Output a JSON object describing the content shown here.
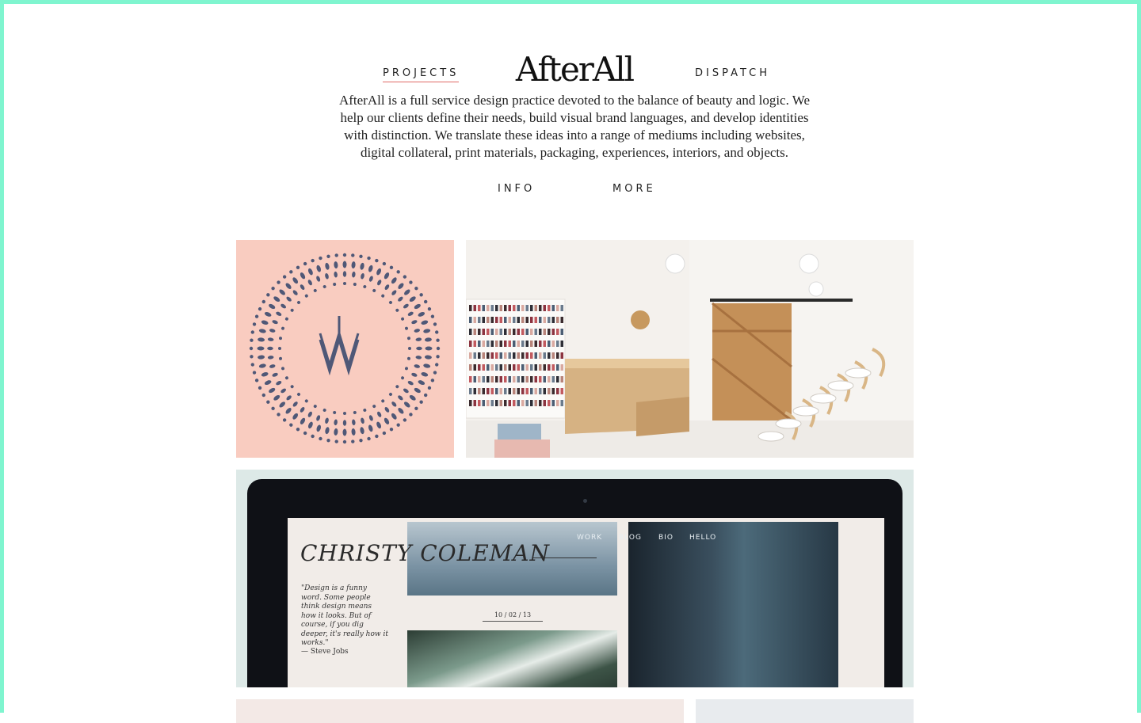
{
  "nav": {
    "projects": "PROJECTS",
    "dispatch": "DISPATCH",
    "info": "INFO",
    "more": "MORE"
  },
  "brand": {
    "logo": "AfterAll"
  },
  "intro": "AfterAll is a full service design practice devoted to the balance of beauty and logic. We help our clients define their needs, build visual brand languages, and develop identities with distinction. We translate these ideas into a range of mediums including websites, digital collateral, print materials, packaging, experiences, interiors, and objects.",
  "projects": {
    "laptop_site": {
      "name": "CHRISTY COLEMAN",
      "nav": [
        "WORK",
        "BLOG",
        "BIO",
        "HELLO"
      ],
      "quote": "\"Design is a funny word. Some people think design means how it looks. But of course, if you dig deeper, it's really how it works.\"",
      "quote_author": "— Steve Jobs",
      "date": "10 / 02 / 13"
    }
  },
  "colors": {
    "frame": "#7ff5cf",
    "accent_underline": "#e06a66",
    "monogram_bg": "#f9ccc0",
    "monogram_ink": "#4f5877",
    "laptop_bg": "#dde9e7"
  }
}
